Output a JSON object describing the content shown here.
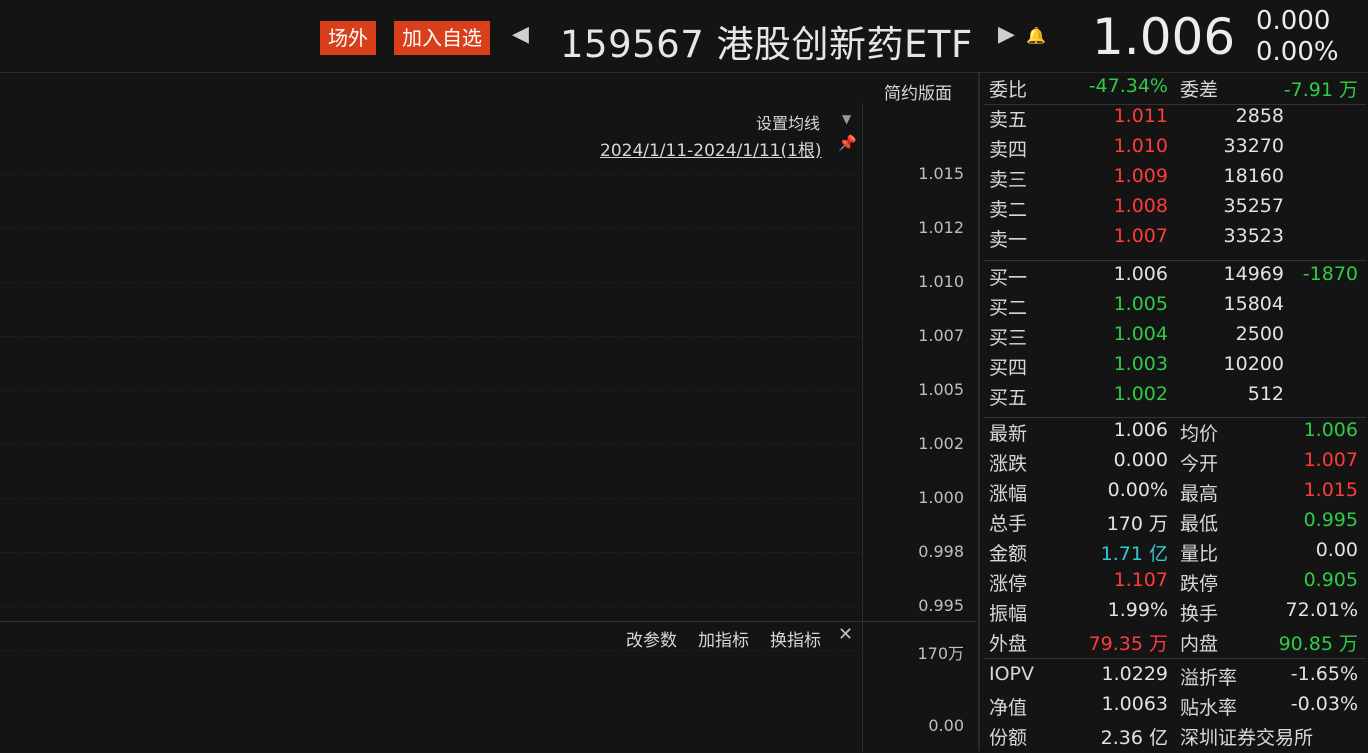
{
  "header": {
    "tag_offsite": "场外",
    "tag_watchlist": "加入自选",
    "prev_icon": "triangle-left-icon",
    "next_icon": "triangle-right-icon",
    "title": "159567 港股创新药ETF",
    "bell_icon": "bell-icon",
    "price": "1.006",
    "change_value": "0.000",
    "change_percent": "0.00%"
  },
  "chart": {
    "mode_link": "简约版面",
    "set_ma": "设置均线",
    "date_range": "2024/1/11-2024/1/11(1根)",
    "price_ticks": [
      "1.015",
      "1.012",
      "1.010",
      "1.007",
      "1.005",
      "1.002",
      "1.000",
      "0.998",
      "0.995"
    ],
    "indicator_buttons": [
      "改参数",
      "加指标",
      "换指标"
    ],
    "volume_ticks": [
      "170万",
      "0.00"
    ],
    "colors": {
      "grid": "#2b2b2b",
      "background": "#141414"
    }
  },
  "panel": {
    "committee": {
      "ratio_label": "委比",
      "ratio_value": "-47.34%",
      "diff_label": "委差",
      "diff_value": "-7.91 万"
    },
    "asks": [
      {
        "label": "卖五",
        "price": "1.011",
        "qty": "2858"
      },
      {
        "label": "卖四",
        "price": "1.010",
        "qty": "33270"
      },
      {
        "label": "卖三",
        "price": "1.009",
        "qty": "18160"
      },
      {
        "label": "卖二",
        "price": "1.008",
        "qty": "35257"
      },
      {
        "label": "卖一",
        "price": "1.007",
        "qty": "33523"
      }
    ],
    "bids": [
      {
        "label": "买一",
        "price": "1.006",
        "qty": "14969",
        "delta": "-1870"
      },
      {
        "label": "买二",
        "price": "1.005",
        "qty": "15804",
        "delta": ""
      },
      {
        "label": "买三",
        "price": "1.004",
        "qty": "2500",
        "delta": ""
      },
      {
        "label": "买四",
        "price": "1.003",
        "qty": "10200",
        "delta": ""
      },
      {
        "label": "买五",
        "price": "1.002",
        "qty": "512",
        "delta": ""
      }
    ],
    "stats": [
      {
        "l1": "最新",
        "v1": "1.006",
        "c1": "white",
        "l2": "均价",
        "v2": "1.006",
        "c2": "green"
      },
      {
        "l1": "涨跌",
        "v1": "0.000",
        "c1": "white",
        "l2": "今开",
        "v2": "1.007",
        "c2": "red"
      },
      {
        "l1": "涨幅",
        "v1": "0.00%",
        "c1": "white",
        "l2": "最高",
        "v2": "1.015",
        "c2": "red"
      },
      {
        "l1": "总手",
        "v1": "170 万",
        "c1": "white",
        "l2": "最低",
        "v2": "0.995",
        "c2": "green"
      },
      {
        "l1": "金额",
        "v1": "1.71 亿",
        "c1": "cyan",
        "l2": "量比",
        "v2": "0.00",
        "c2": "white"
      },
      {
        "l1": "涨停",
        "v1": "1.107",
        "c1": "red",
        "l2": "跌停",
        "v2": "0.905",
        "c2": "green"
      },
      {
        "l1": "振幅",
        "v1": "1.99%",
        "c1": "white",
        "l2": "换手",
        "v2": "72.01%",
        "c2": "white"
      },
      {
        "l1": "外盘",
        "v1": "79.35 万",
        "c1": "red",
        "l2": "内盘",
        "v2": "90.85 万",
        "c2": "green"
      }
    ],
    "fund": [
      {
        "l1": "IOPV",
        "v1": "1.0229",
        "l2": "溢折率",
        "v2": "-1.65%"
      },
      {
        "l1": "净值",
        "v1": "1.0063",
        "l2": "贴水率",
        "v2": "-0.03%"
      },
      {
        "l1": "份额",
        "v1": "2.36 亿",
        "l2": "深圳证券交易所",
        "v2": ""
      }
    ],
    "colors": {
      "up": "#ff3b3b",
      "down": "#2ecb46",
      "neutral": "#e2e2e2",
      "amount": "#32c8d2"
    }
  }
}
